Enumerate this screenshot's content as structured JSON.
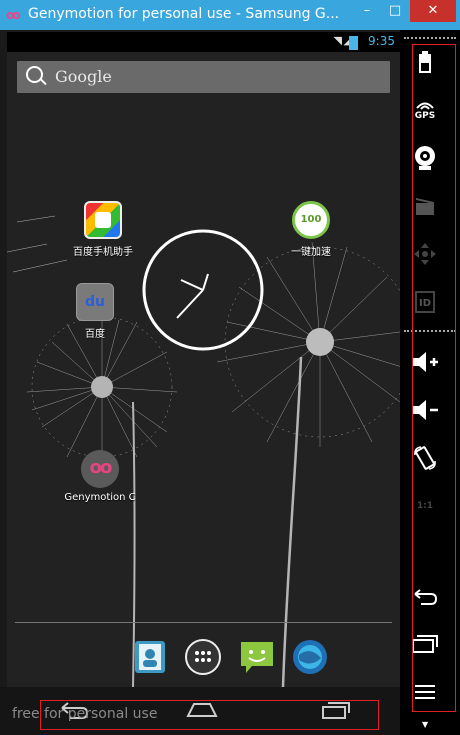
{
  "window": {
    "title": "Genymotion for personal use - Samsung G...",
    "app_icon": "oo",
    "minimize": "–",
    "maximize": "□",
    "close": "✕"
  },
  "statusbar": {
    "time": "9:35"
  },
  "search": {
    "placeholder": "Google"
  },
  "home": {
    "apps": [
      {
        "label": "百度手机助手",
        "icon": "baidu-assistant-icon"
      },
      {
        "label": "一键加速",
        "icon": "speed-boost-icon",
        "badge": "100"
      },
      {
        "label": "百度",
        "icon": "baidu-icon",
        "glyph": "du"
      },
      {
        "label": "Genymotion C",
        "icon": "genymotion-icon",
        "glyph": "oo"
      }
    ],
    "dock": [
      {
        "name": "contacts-icon"
      },
      {
        "name": "app-drawer-icon"
      },
      {
        "name": "messaging-icon"
      },
      {
        "name": "browser-icon"
      }
    ]
  },
  "watermark": "free for personal use",
  "sidebar": {
    "items": [
      {
        "name": "battery-icon"
      },
      {
        "name": "gps-icon",
        "text": "GPS"
      },
      {
        "name": "camera-icon"
      },
      {
        "name": "capture-icon"
      },
      {
        "name": "dpad-icon"
      },
      {
        "name": "id-icon",
        "text": "ID"
      },
      {
        "name": "volume-up-icon"
      },
      {
        "name": "volume-down-icon"
      },
      {
        "name": "rotate-icon"
      },
      {
        "name": "scale-icon",
        "text": "1:1"
      },
      {
        "name": "back-icon"
      },
      {
        "name": "recent-apps-icon"
      },
      {
        "name": "menu-icon"
      }
    ]
  },
  "colors": {
    "accent": "#4ab6e8",
    "titlebar": "#3aa6de",
    "close": "#c7302b",
    "highlight": "#e02020"
  }
}
